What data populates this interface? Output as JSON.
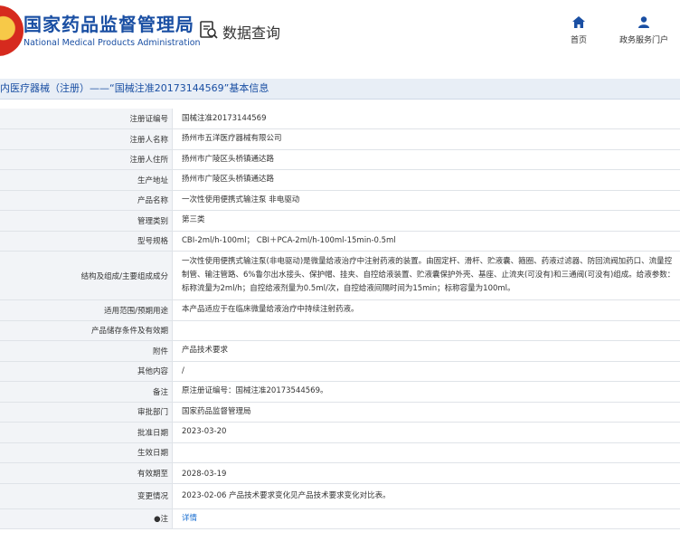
{
  "header": {
    "org_cn": "国家药品监督管理局",
    "org_en": "National Medical Products Administration",
    "search_label": "数据查询",
    "nav_home": "首页",
    "nav_service": "政务服务门户",
    "accent": "#1a4fa3"
  },
  "page": {
    "title": "内医疗器械（注册）——“国械注准20173144569”基本信息"
  },
  "rows": [
    {
      "label": "注册证编号",
      "value": "国械注准20173144569"
    },
    {
      "label": "注册人名称",
      "value": "扬州市五洋医疗器械有限公司"
    },
    {
      "label": "注册人住所",
      "value": "扬州市广陵区头桥镇通达路"
    },
    {
      "label": "生产地址",
      "value": "扬州市广陵区头桥镇通达路"
    },
    {
      "label": "产品名称",
      "value": "一次性使用便携式输注泵 非电驱动"
    },
    {
      "label": "管理类别",
      "value": "第三类"
    },
    {
      "label": "型号规格",
      "value": "CBI-2ml/h-100ml； CBI＋PCA-2ml/h-100ml-15min-0.5ml"
    },
    {
      "label": "结构及组成/主要组成成分",
      "value": "一次性使用便携式输注泵(非电驱动)是微量给液治疗中注射药液的装置。由固定杆、滑杆、贮液囊、箍圈、药液过滤器、防回流阀加药口、流量控制管、输注管路、6%鲁尔出水接头、保护帽、挂夹、自控给液装置、贮液囊保护外壳、基座、止流夹(可没有)和三通阀(可没有)组成。给液参数：标称流量为2ml/h；自控给液剂量为0.5ml/次，自控给液间隔时间为15min；标称容量为100ml。"
    },
    {
      "label": "适用范围/预期用途",
      "value": "本产品适应于在临床微量给液治疗中持续注射药液。"
    },
    {
      "label": "产品储存条件及有效期",
      "value": ""
    },
    {
      "label": "附件",
      "value": "产品技术要求"
    },
    {
      "label": "其他内容",
      "value": "/"
    },
    {
      "label": "备注",
      "value": "原注册证编号：国械注准20173544569。"
    },
    {
      "label": "审批部门",
      "value": "国家药品监督管理局"
    },
    {
      "label": "批准日期",
      "value": "2023-03-20"
    },
    {
      "label": "生效日期",
      "value": ""
    },
    {
      "label": "有效期至",
      "value": "2028-03-19"
    },
    {
      "label": "变更情况",
      "value": "2023-02-06 产品技术要求变化见产品技术要求变化对比表。"
    },
    {
      "label": "●注",
      "value": "详情"
    }
  ]
}
